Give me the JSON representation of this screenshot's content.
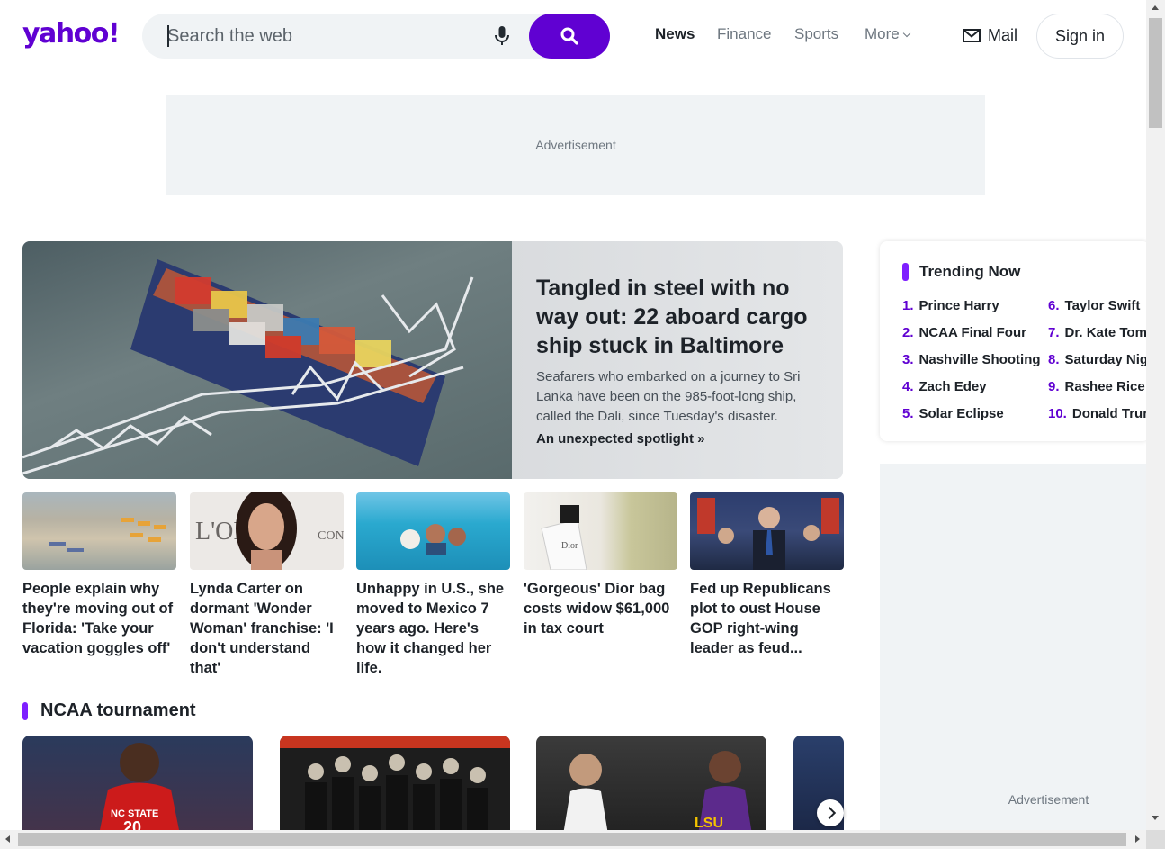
{
  "header": {
    "logo": "yahoo!",
    "search_placeholder": "Search the web",
    "nav": [
      "News",
      "Finance",
      "Sports",
      "More"
    ],
    "mail_label": "Mail",
    "signin_label": "Sign in"
  },
  "ads": {
    "top_label": "Advertisement",
    "side_label": "Advertisement"
  },
  "hero": {
    "title": "Tangled in steel with no way out: 22 aboard cargo ship stuck in Baltimore",
    "summary": "Seafarers who embarked on a journey to Sri Lanka have been on the 985-foot-long ship, called the Dali, since Tuesday's disaster.",
    "link": "An unexpected spotlight »",
    "image": "cargo-ship-under-collapsed-bridge"
  },
  "stories": [
    {
      "title": "People explain why they're moving out of Florida: 'Take your vacation goggles off'",
      "image": "crowded-beach"
    },
    {
      "title": "Lynda Carter on dormant 'Wonder Woman' franchise: 'I don't understand that'",
      "image": "actress-portrait"
    },
    {
      "title": "Unhappy in U.S., she moved to Mexico 7 years ago. Here's how it changed her life.",
      "image": "people-swimming-with-dog"
    },
    {
      "title": "'Gorgeous' Dior bag costs widow $61,000 in tax court",
      "image": "dior-shopping-bag"
    },
    {
      "title": "Fed up Republicans plot to oust House GOP right-wing leader as feud...",
      "image": "congressman-speaking"
    }
  ],
  "section": {
    "title": "NCAA tournament",
    "cards": [
      "nc-state-player",
      "iowa-team-celebration",
      "womens-basketball-players",
      "basketball-game"
    ]
  },
  "trending": {
    "title": "Trending Now",
    "items": [
      {
        "num": "1.",
        "label": "Prince Harry"
      },
      {
        "num": "2.",
        "label": "NCAA Final Four"
      },
      {
        "num": "3.",
        "label": "Nashville Shooting"
      },
      {
        "num": "4.",
        "label": "Zach Edey"
      },
      {
        "num": "5.",
        "label": "Solar Eclipse"
      },
      {
        "num": "6.",
        "label": "Taylor Swift"
      },
      {
        "num": "7.",
        "label": "Dr. Kate Toma"
      },
      {
        "num": "8.",
        "label": "Saturday Nig"
      },
      {
        "num": "9.",
        "label": "Rashee Rice"
      },
      {
        "num": "10.",
        "label": "Donald Trur"
      }
    ]
  },
  "colors": {
    "brand": "#6001d2",
    "accent_bar": "#7e1fff",
    "text": "#1d2228",
    "muted": "#6e7780",
    "ad_bg": "#f0f3f5"
  }
}
